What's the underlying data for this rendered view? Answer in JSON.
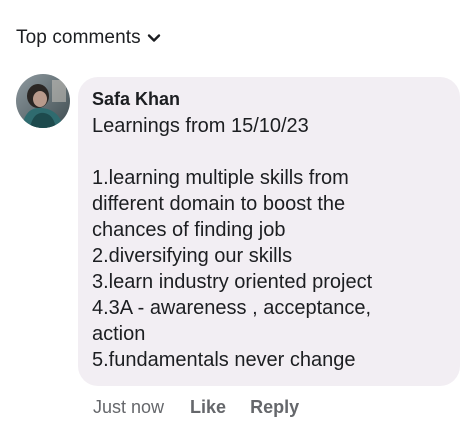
{
  "header": {
    "sort_label": "Top comments",
    "sort_icon": "chevron-down-icon"
  },
  "comment": {
    "avatar_icon": "avatar",
    "author": "Safa Khan",
    "lines": {
      "0": "Learnings from 15/10/23",
      "1": "",
      "2": "1.learning multiple skills from",
      "3": "different domain to boost the",
      "4": "chances of finding job",
      "5": "2.diversifying our skills",
      "6": "3.learn industry oriented project",
      "7": "4.3A - awareness , acceptance,",
      "8": "action",
      "9": "5.fundamentals never change"
    },
    "bubble_color": "#f2eef3"
  },
  "actions": {
    "timestamp": "Just now",
    "like_label": "Like",
    "reply_label": "Reply"
  }
}
